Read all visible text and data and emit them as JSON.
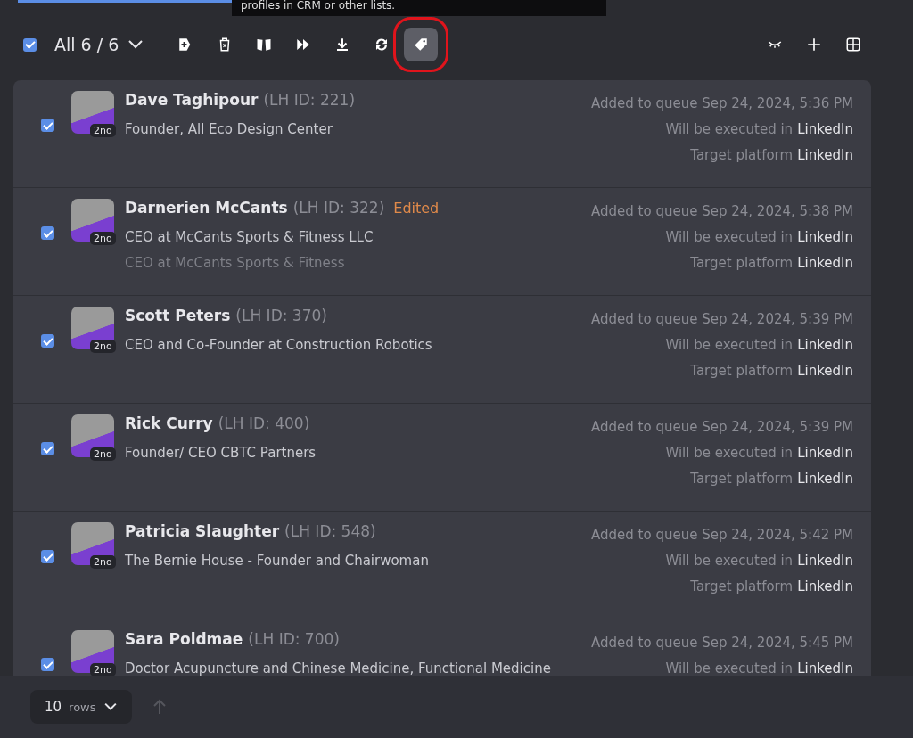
{
  "tooltip": {
    "text": "profiles in CRM or other lists."
  },
  "toolbar": {
    "select_all": {
      "checked": true
    },
    "selection": "All 6 / 6",
    "actions": [
      {
        "kind": "add",
        "selected": false
      },
      {
        "kind": "delete",
        "selected": false
      },
      {
        "kind": "cards",
        "selected": false
      },
      {
        "kind": "skip",
        "selected": false
      },
      {
        "kind": "download",
        "selected": false
      },
      {
        "kind": "sync",
        "selected": false
      },
      {
        "kind": "tag",
        "selected": true
      }
    ],
    "right_actions": [
      {
        "kind": "hide"
      },
      {
        "kind": "plus"
      },
      {
        "kind": "grid"
      }
    ]
  },
  "rows": [
    {
      "checked": true,
      "name": "Dave Taghipour",
      "id": "(LH ID: 221)",
      "degree": "2nd",
      "title": "Founder, All Eco Design Center",
      "added": "Added to queue Sep 24, 2024, 5:36 PM",
      "executed_label": "Will be executed in",
      "executed": "LinkedIn",
      "target_label": "Target platform",
      "target": "LinkedIn"
    },
    {
      "checked": true,
      "name": "Darnerien McCants",
      "id": "(LH ID: 322)",
      "edited": "Edited",
      "degree": "2nd",
      "title": "CEO at McCants Sports & Fitness LLC",
      "original_title": "CEO at McCants Sports & Fitness",
      "added": "Added to queue Sep 24, 2024, 5:38 PM",
      "executed_label": "Will be executed in",
      "executed": "LinkedIn",
      "target_label": "Target platform",
      "target": "LinkedIn"
    },
    {
      "checked": true,
      "name": "Scott Peters",
      "id": "(LH ID: 370)",
      "degree": "2nd",
      "title": "CEO and Co-Founder at Construction Robotics",
      "added": "Added to queue Sep 24, 2024, 5:39 PM",
      "executed_label": "Will be executed in",
      "executed": "LinkedIn",
      "target_label": "Target platform",
      "target": "LinkedIn"
    },
    {
      "checked": true,
      "name": "Rick Curry",
      "id": "(LH ID: 400)",
      "degree": "2nd",
      "title": "Founder/ CEO CBTC Partners",
      "added": "Added to queue Sep 24, 2024, 5:39 PM",
      "executed_label": "Will be executed in",
      "executed": "LinkedIn",
      "target_label": "Target platform",
      "target": "LinkedIn"
    },
    {
      "checked": true,
      "name": "Patricia Slaughter",
      "id": "(LH ID: 548)",
      "degree": "2nd",
      "title": "The Bernie House - Founder and Chairwoman",
      "added": "Added to queue Sep 24, 2024, 5:42 PM",
      "executed_label": "Will be executed in",
      "executed": "LinkedIn",
      "target_label": "Target platform",
      "target": "LinkedIn"
    },
    {
      "checked": true,
      "name": "Sara Poldmae",
      "id": "(LH ID: 700)",
      "degree": "2nd",
      "title": "Doctor Acupuncture and Chinese Medicine, Functional Medicine",
      "added": "Added to queue Sep 24, 2024, 5:45 PM",
      "executed_label": "Will be executed in",
      "executed": "LinkedIn"
    }
  ],
  "footer": {
    "rows_count": "10",
    "rows_label": "rows"
  }
}
